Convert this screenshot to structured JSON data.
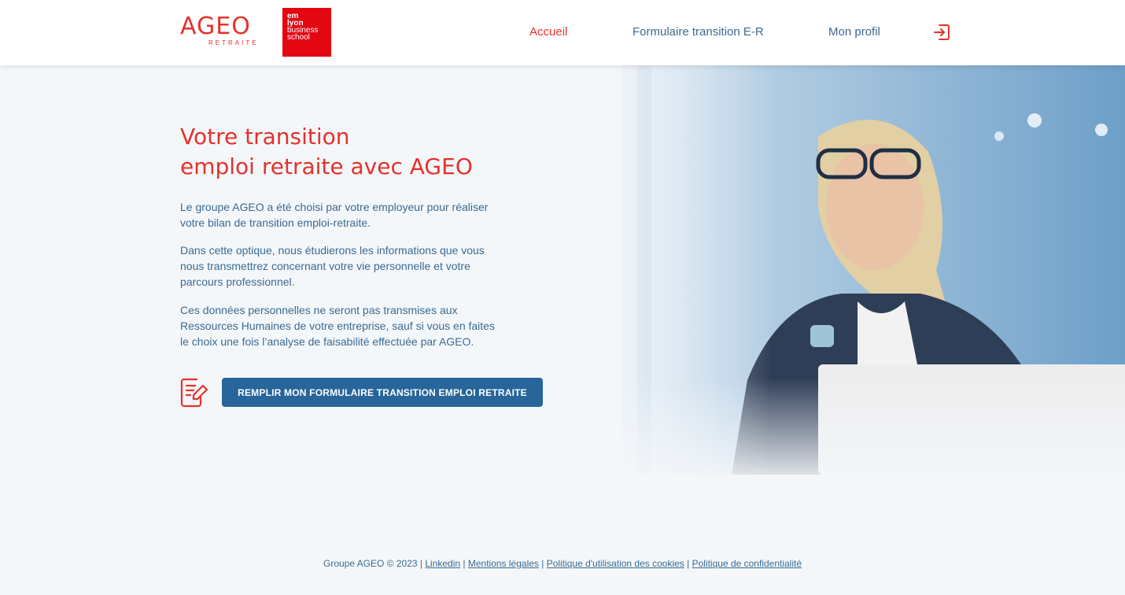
{
  "header": {
    "logo_ageo": {
      "main": "AGEO",
      "sub": "RETRAITE"
    },
    "logo_em": {
      "line1": "em",
      "line2": "lyon",
      "line3": "business",
      "line4": "school"
    },
    "nav": [
      {
        "label": "Accueil",
        "active": true
      },
      {
        "label": "Formulaire transition E-R",
        "active": false
      },
      {
        "label": "Mon profil",
        "active": false
      }
    ],
    "logout_icon": "logout-icon"
  },
  "main": {
    "title_line1": "Votre transition",
    "title_line2": "emploi retraite avec AGEO",
    "paragraphs": [
      "Le groupe AGEO a été choisi par votre employeur pour réaliser votre bilan de transition emploi-retraite.",
      "Dans cette optique, nous étudierons les informations que vous nous transmettrez concernant votre vie personnelle et votre parcours professionnel.",
      "Ces données personnelles ne seront pas transmises aux Ressources Humaines de votre entreprise, sauf si vous en faites le choix une fois l’analyse de faisabilité effectuée par AGEO."
    ],
    "cta_label": "REMPLIR MON FORMULAIRE TRANSITION EMPLOI RETRAITE",
    "cta_icon": "form-edit-icon"
  },
  "footer": {
    "copyright": "Groupe AGEO © 2023",
    "links": [
      "Linkedin",
      "Mentions légales",
      "Politique d'utilisation des cookies",
      "Politique de confidentialité"
    ]
  },
  "colors": {
    "accent": "#e4322b",
    "primary": "#27659a",
    "text": "#3a6a93",
    "background": "#f4f7fa"
  }
}
